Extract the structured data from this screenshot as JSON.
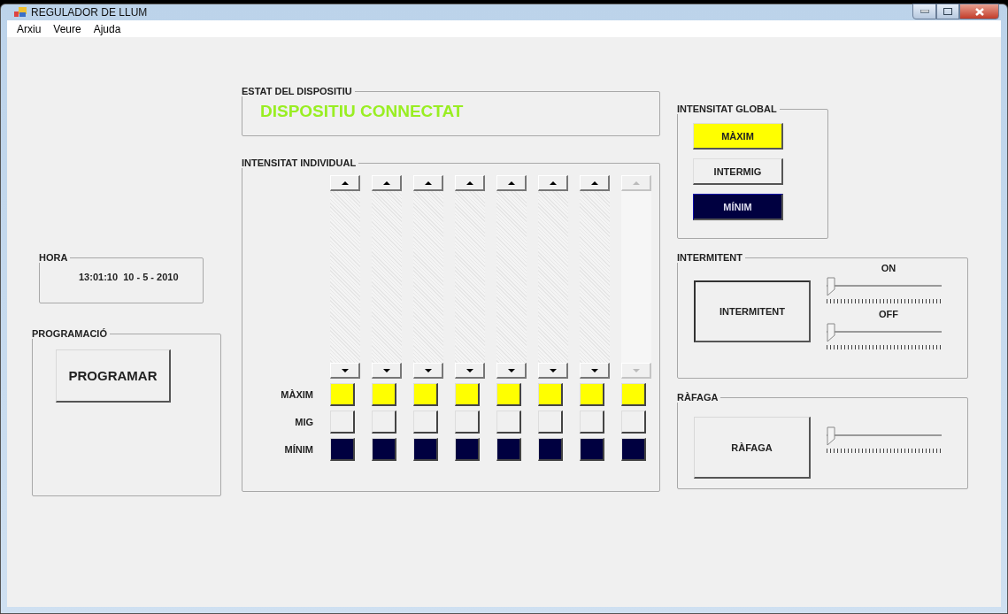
{
  "window": {
    "title": "REGULADOR DE LLUM"
  },
  "menu": [
    "Arxiu",
    "Veure",
    "Ajuda"
  ],
  "clock": {
    "title": "HORA",
    "value": "13:01:10  10 - 5 - 2010"
  },
  "programming": {
    "title": "PROGRAMACIÓ",
    "button": "PROGRAMAR"
  },
  "device_status": {
    "title": "ESTAT DEL DISPOSITIU",
    "value": "DISPOSITIU CONNECTAT",
    "color": "#99ee22"
  },
  "individual": {
    "title": "INTENSITAT INDIVIDUAL",
    "levels": [
      {
        "label": "MÀXIM",
        "color": "#ffff00"
      },
      {
        "label": "MIG",
        "color": "#f0f0f0"
      },
      {
        "label": "MÍNIM",
        "color": "#000040"
      }
    ],
    "channels": [
      {
        "disabled": false
      },
      {
        "disabled": false
      },
      {
        "disabled": false
      },
      {
        "disabled": false
      },
      {
        "disabled": false
      },
      {
        "disabled": false
      },
      {
        "disabled": false
      },
      {
        "disabled": true
      }
    ]
  },
  "global": {
    "title": "INTENSITAT GLOBAL",
    "buttons": [
      {
        "label": "MÀXIM",
        "color": "#ffff00"
      },
      {
        "label": "INTERMIG",
        "color": "#f0f0f0"
      },
      {
        "label": "MÍNIM",
        "color": "#000040"
      }
    ]
  },
  "blink": {
    "title": "INTERMITENT",
    "button": "INTERMITENT",
    "sliders": [
      {
        "label": "ON",
        "level": 0
      },
      {
        "label": "OFF",
        "level": 0
      }
    ]
  },
  "burst": {
    "title": "RÀFAGA",
    "button": "RÀFAGA",
    "slider": {
      "level": 0
    }
  }
}
